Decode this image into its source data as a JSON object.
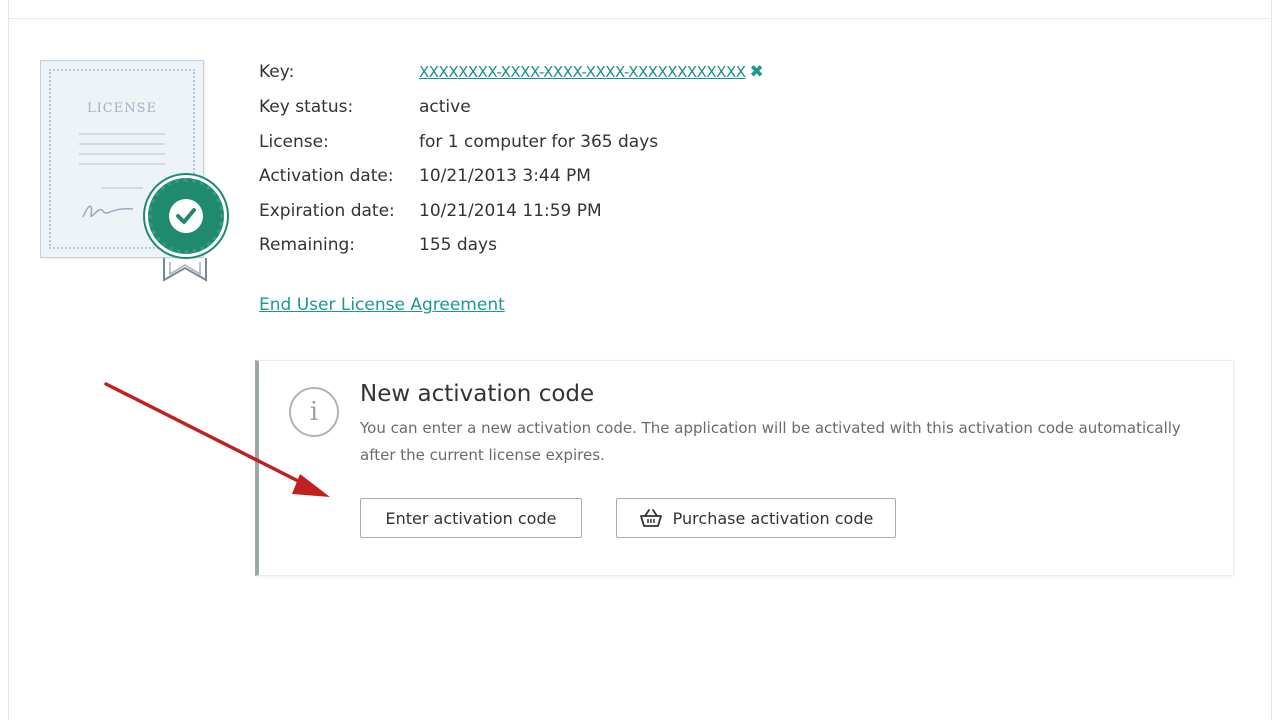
{
  "license_info": {
    "key_label": "Key:",
    "key_value": "XXXXXXXX-XXXX-XXXX-XXXX-XXXXXXXXXXXX",
    "key_status_label": "Key status:",
    "key_status_value": "active",
    "license_label": "License:",
    "license_value": "for 1 computer for 365 days",
    "activation_date_label": "Activation date:",
    "activation_date_value": "10/21/2013 3:44 PM",
    "expiration_date_label": "Expiration date:",
    "expiration_date_value": "10/21/2014 11:59 PM",
    "remaining_label": "Remaining:",
    "remaining_value": "155 days"
  },
  "eula_link": "End User License Agreement",
  "certificate": {
    "title": "LICENSE"
  },
  "activation_panel": {
    "title": "New activation code",
    "description": "You can enter a new activation code. The application will be activated with this activation code automatically after the current license expires.",
    "enter_button": "Enter activation code",
    "purchase_button": "Purchase activation code"
  },
  "icons": {
    "remove_key": "close-icon",
    "info": "info-icon",
    "basket": "basket-icon",
    "check": "check-icon"
  },
  "colors": {
    "link": "#1a8f8f",
    "seal": "#1f8a6e",
    "arrow": "#c0201f"
  }
}
